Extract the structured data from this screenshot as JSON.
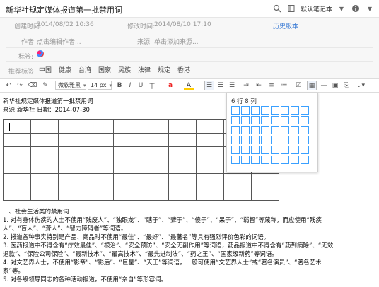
{
  "note_title": "新华社规定媒体报道第一批禁用词",
  "notebook": "默认笔记本",
  "meta": {
    "created_label": "创建时间:",
    "created_value": "2014/08/02 10:36",
    "modified_label": "修改时间:",
    "modified_value": "2014/08/10 17:10",
    "history_link": "历史版本",
    "author_label": "作者:",
    "author_placeholder": "点击编辑作者...",
    "source_label": "来源:",
    "source_placeholder": "单击添加来源...",
    "tags_label": "标签:",
    "recommended_label": "推荐标签:",
    "recommended_tags": [
      "中国",
      "健康",
      "台湾",
      "国家",
      "民族",
      "法律",
      "规定",
      "香港"
    ]
  },
  "toolbar": {
    "font_family": "微软雅黑",
    "font_size": "14 px",
    "bold": "B",
    "italic": "I",
    "underline": "U",
    "strike": "干",
    "font_color": "a",
    "highlight": "A"
  },
  "table_popup": {
    "label": "6 行 8 列",
    "rows": 6,
    "cols": 8
  },
  "content": {
    "heading": "新华社规定媒体报道第一批禁用词",
    "source_line": "来源:新华社 日期：2014-07-30",
    "lines": [
      "一、社会生活类的禁用词",
      "1. 对有身体伤疾的人士不使用“残废人”、“独眼龙”、“瞎子”、“聋子”、“傻子”、“呆子”、“弱智”等蔑称，而应使用“残疾",
      "人”、“盲人”、“聋人”、“智力障碍者”等词语。",
      "2. 报道各种事实特别是产品、商品时不使用“最佳”、“最好”、“最著名”等具有强烈评价色彩的词语。",
      "3. 医药报道中不得含有“疗效最佳”、“根治”、“安全预防”、“安全无副作用”等词语，药品报道中不得含有“药到病除”、“无效",
      "退款”、“保险公司保险”、“最新技术”、“最高技术”、“最先进制法”、“药之王”、“国家级新药”等词语。",
      "4. 对文艺界人士，不使用“影帝”、“影后”、“巨星”、“天王”等词语，一般可使用“文艺界人士”或“著名演员”、“著名艺术",
      "家”等。",
      "5. 对各级领导同志的各种活动报道，不使用“亲自”等形容词。"
    ]
  }
}
